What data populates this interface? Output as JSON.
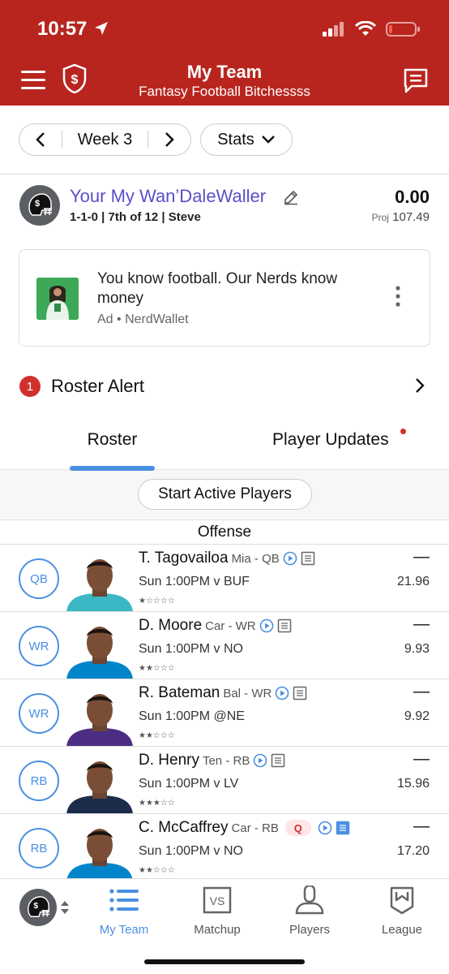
{
  "status": {
    "time": "10:57"
  },
  "header": {
    "title": "My Team",
    "subtitle": "Fantasy Football Bitchessss"
  },
  "week": {
    "label": "Week 3"
  },
  "stats": {
    "label": "Stats"
  },
  "team": {
    "name": "Your My Wan’DaleWaller",
    "record": "1-1-0 | 7th of 12 | Steve",
    "score": "0.00",
    "proj_label": "Proj",
    "proj_value": "107.49"
  },
  "ad": {
    "text": "You know football. Our Nerds know money",
    "sponsor": "Ad • NerdWallet"
  },
  "alert": {
    "count": "1",
    "label": "Roster Alert"
  },
  "tabs": {
    "roster": "Roster",
    "updates": "Player Updates"
  },
  "start_active": "Start Active Players",
  "section": "Offense",
  "players": [
    {
      "pos": "QB",
      "name": "T. Tagovailoa",
      "team": "Mia - QB",
      "game": "Sun 1:00PM v BUF",
      "dash": "—",
      "proj": "21.96",
      "stars": "★☆☆☆☆",
      "rating": 1,
      "jersey": "#3bb8c4"
    },
    {
      "pos": "WR",
      "name": "D. Moore",
      "team": "Car - WR",
      "game": "Sun 1:00PM v NO",
      "dash": "—",
      "proj": "9.93",
      "stars": "★★☆☆☆",
      "rating": 2,
      "jersey": "#0085ca"
    },
    {
      "pos": "WR",
      "name": "R. Bateman",
      "team": "Bal - WR",
      "game": "Sun 1:00PM @NE",
      "dash": "—",
      "proj": "9.92",
      "stars": "★★☆☆☆",
      "rating": 2,
      "jersey": "#4b2e83"
    },
    {
      "pos": "RB",
      "name": "D. Henry",
      "team": "Ten - RB",
      "game": "Sun 1:00PM v LV",
      "dash": "—",
      "proj": "15.96",
      "stars": "★★★☆☆",
      "rating": 3,
      "jersey": "#1c2c4a"
    },
    {
      "pos": "RB",
      "name": "C. McCaffrey",
      "team": "Car - RB",
      "badge": "Q",
      "game": "Sun 1:00PM v NO",
      "dash": "—",
      "proj": "17.20",
      "stars": "★★☆☆☆",
      "rating": 2,
      "jersey": "#0085ca"
    }
  ],
  "nav": {
    "my_team": "My Team",
    "matchup": "Matchup",
    "players": "Players",
    "league": "League"
  },
  "colors": {
    "header": "#b8251f",
    "accent": "#4a90e2",
    "alert": "#d0312d",
    "team_name": "#5a4fc8"
  }
}
